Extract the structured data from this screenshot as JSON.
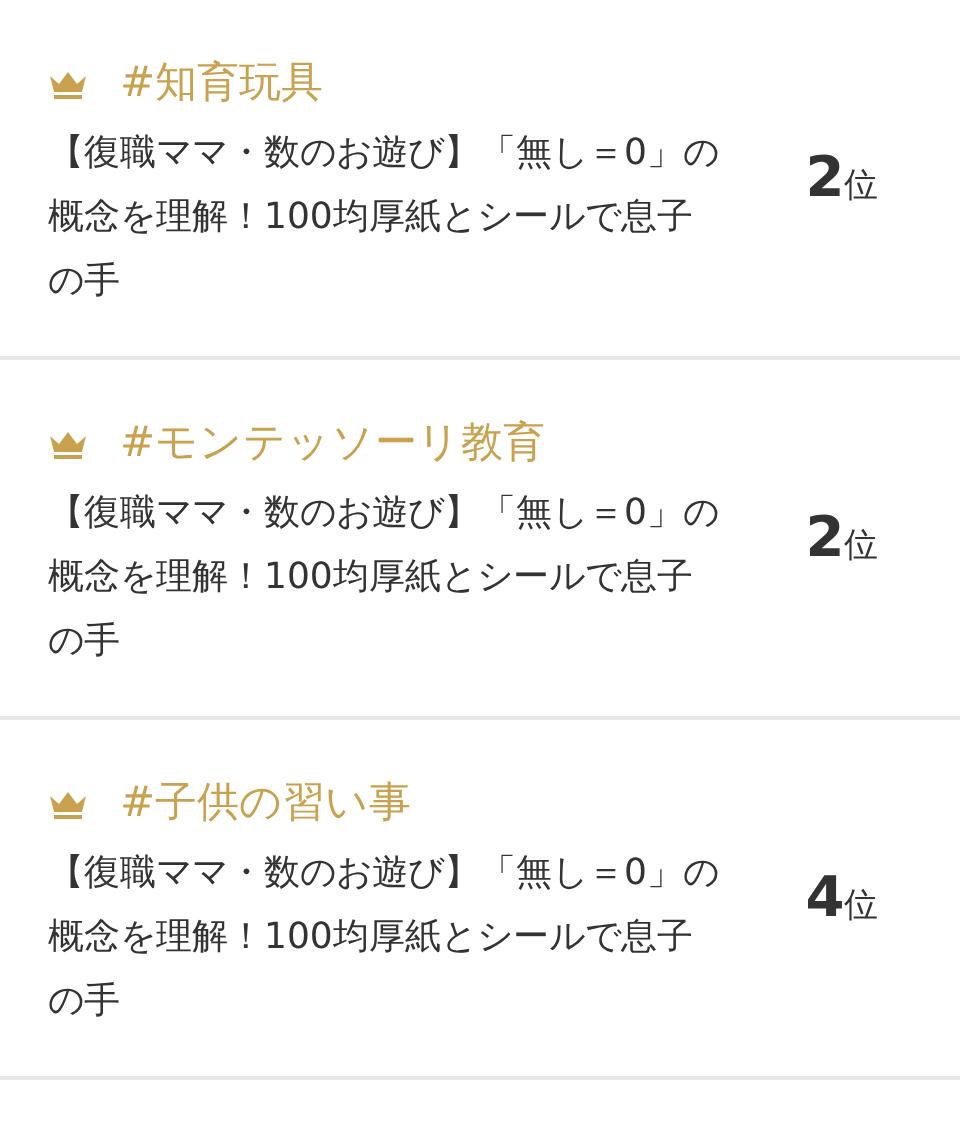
{
  "items": [
    {
      "tag": "#知育玩具",
      "title": "【復職ママ・数のお遊び】「無し＝0」の概念を理解！100均厚紙とシールで息子の手",
      "rank": "2",
      "rank_unit": "位"
    },
    {
      "tag": "#モンテッソーリ教育",
      "title": "【復職ママ・数のお遊び】「無し＝0」の概念を理解！100均厚紙とシールで息子の手",
      "rank": "2",
      "rank_unit": "位"
    },
    {
      "tag": "#子供の習い事",
      "title": "【復職ママ・数のお遊び】「無し＝0」の概念を理解！100均厚紙とシールで息子の手",
      "rank": "4",
      "rank_unit": "位"
    }
  ]
}
